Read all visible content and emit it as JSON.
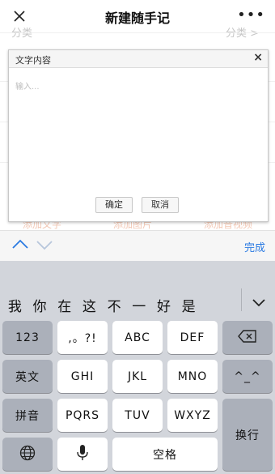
{
  "nav": {
    "title": "新建随手记",
    "more": "•••"
  },
  "background": {
    "category_left": "分类",
    "category_right": "分类 >",
    "links": [
      "添加文字",
      "添加图片",
      "添加音视频"
    ]
  },
  "dialog": {
    "title": "文字内容",
    "close": "×",
    "input_placeholder": "输入...",
    "ok_label": "确定",
    "cancel_label": "取消"
  },
  "toolbar": {
    "done_label": "完成"
  },
  "candidates": [
    "我",
    "你",
    "在",
    "这",
    "不",
    "一",
    "好",
    "是"
  ],
  "keyboard": {
    "row1": {
      "num": "123",
      "punct": ",。?!",
      "abc": "ABC",
      "def": "DEF"
    },
    "row2": {
      "en": "英文",
      "ghi": "GHI",
      "jkl": "JKL",
      "mno": "MNO",
      "emoji": "^_^"
    },
    "row3": {
      "pinyin": "拼音",
      "pqrs": "PQRS",
      "tuv": "TUV",
      "wxyz": "WXYZ",
      "newline": "换行"
    },
    "row4": {
      "space": "空格"
    }
  },
  "colors": {
    "accent": "#2a7ae2",
    "keyboard_bg": "#d2d5db",
    "key_dark": "#abb0ba"
  }
}
